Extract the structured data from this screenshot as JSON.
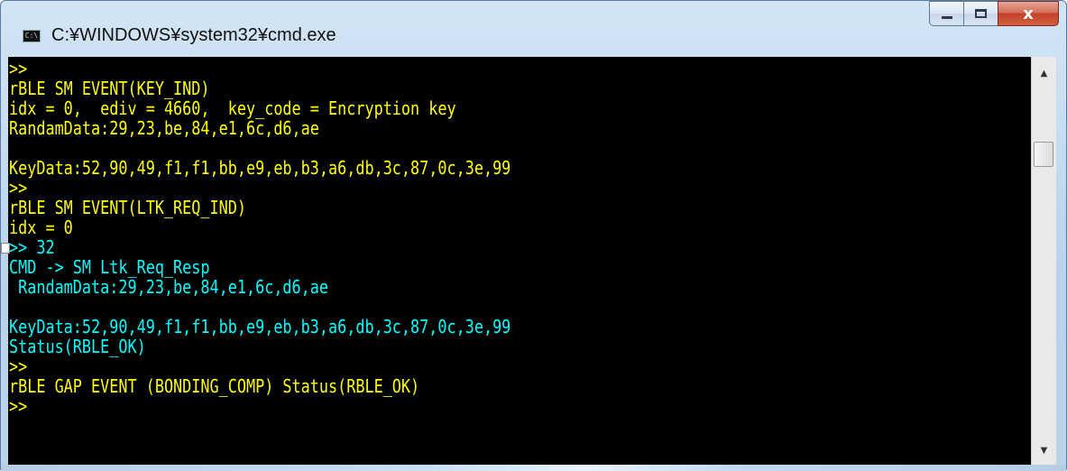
{
  "window": {
    "title": "C:¥WINDOWS¥system32¥cmd.exe",
    "icon": "cmd-icon",
    "buttons": {
      "minimize": "minimize-icon",
      "maximize": "maximize-icon",
      "close": "x"
    }
  },
  "console": {
    "background": "#000000",
    "lines": [
      {
        "text": ">>",
        "color": "yellow"
      },
      {
        "text": "rBLE SM EVENT(KEY_IND)",
        "color": "yellow"
      },
      {
        "text": "idx = 0,  ediv = 4660,  key_code = Encryption key",
        "color": "yellow"
      },
      {
        "text": "RandamData:29,23,be,84,e1,6c,d6,ae",
        "color": "yellow"
      },
      {
        "text": "",
        "color": "yellow"
      },
      {
        "text": "KeyData:52,90,49,f1,f1,bb,e9,eb,b3,a6,db,3c,87,0c,3e,99",
        "color": "yellow"
      },
      {
        "text": ">>",
        "color": "yellow"
      },
      {
        "text": "rBLE SM EVENT(LTK_REQ_IND)",
        "color": "yellow"
      },
      {
        "text": "idx = 0",
        "color": "yellow"
      },
      {
        "text": ">> 32",
        "color": "cyan"
      },
      {
        "text": "CMD -> SM Ltk_Req_Resp",
        "color": "cyan"
      },
      {
        "text": " RandamData:29,23,be,84,e1,6c,d6,ae",
        "color": "cyan"
      },
      {
        "text": "",
        "color": "cyan"
      },
      {
        "text": "KeyData:52,90,49,f1,f1,bb,e9,eb,b3,a6,db,3c,87,0c,3e,99",
        "color": "cyan"
      },
      {
        "text": "Status(RBLE_OK)",
        "color": "cyan"
      },
      {
        "text": ">>",
        "color": "yellow"
      },
      {
        "text": "rBLE GAP EVENT (BONDING_COMP) Status(RBLE_OK)",
        "color": "yellow"
      },
      {
        "text": ">>",
        "color": "yellow"
      }
    ]
  },
  "scrollbar": {
    "up_icon": "scroll-up-arrow-icon",
    "down_icon": "scroll-down-arrow-icon"
  },
  "colors": {
    "yellow": "#ffff00",
    "cyan": "#00ffff",
    "close_button": "#c24128"
  }
}
